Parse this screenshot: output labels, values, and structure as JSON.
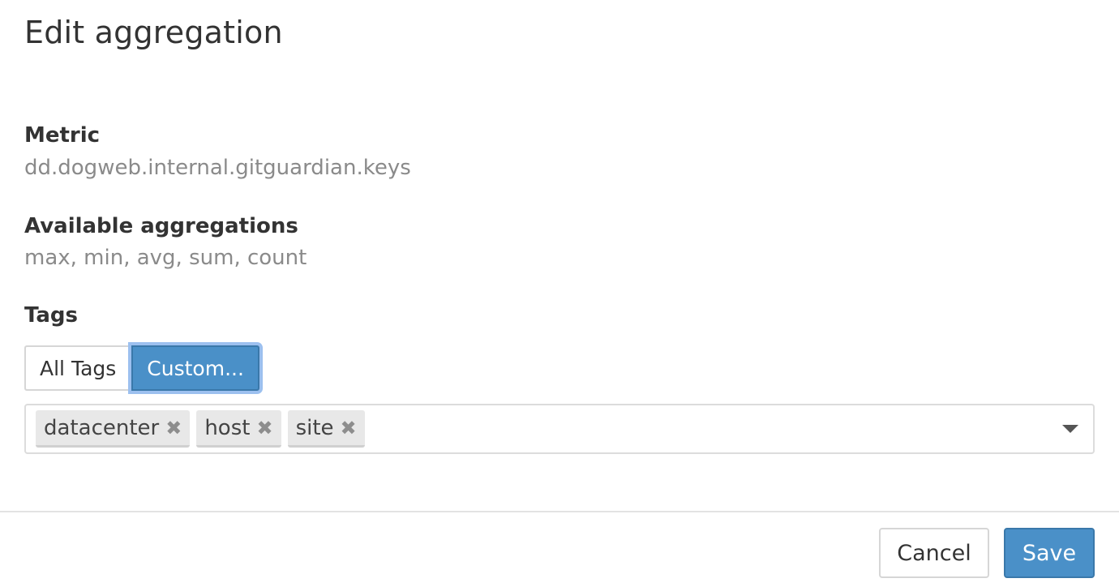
{
  "dialog": {
    "title": "Edit aggregation"
  },
  "metric": {
    "label": "Metric",
    "value": "dd.dogweb.internal.gitguardian.keys"
  },
  "aggregations": {
    "label": "Available aggregations",
    "value": "max, min, avg, sum, count"
  },
  "tags": {
    "label": "Tags",
    "mode_options": [
      "All Tags",
      "Custom..."
    ],
    "selected_mode": "Custom...",
    "selected_tags": [
      "datacenter",
      "host",
      "site"
    ],
    "remove_glyph": "✖",
    "dropdown_icon": "caret-down-icon"
  },
  "footer": {
    "cancel_label": "Cancel",
    "save_label": "Save"
  },
  "colors": {
    "primary": "#4a90c8",
    "focus_ring": "#9cc0ef",
    "muted_text": "#8a8a8a"
  }
}
